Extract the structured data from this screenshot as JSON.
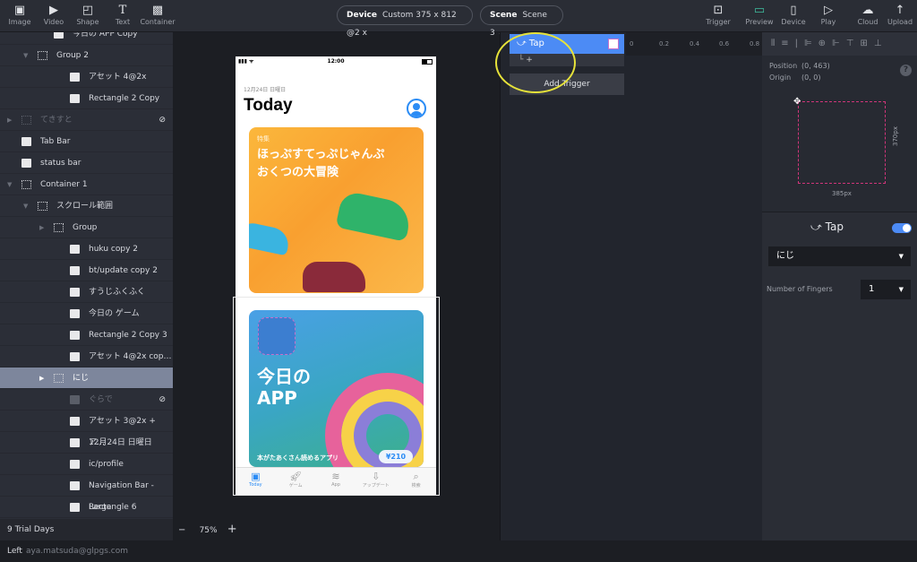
{
  "toolbar": {
    "tools": [
      {
        "label": "Image",
        "icon": "image-icon"
      },
      {
        "label": "Video",
        "icon": "video-icon"
      },
      {
        "label": "Shape",
        "icon": "shape-icon"
      },
      {
        "label": "Text",
        "icon": "text-icon"
      },
      {
        "label": "Container",
        "icon": "container-icon"
      }
    ],
    "device_label": "Device",
    "device_value": "Custom  375 x 812  @2 x",
    "scene_label": "Scene",
    "scene_value": "Scene 3",
    "actions": [
      {
        "label": "Trigger",
        "icon": "trigger-icon"
      },
      {
        "label": "Preview",
        "icon": "preview-icon"
      },
      {
        "label": "Device",
        "icon": "device-icon"
      },
      {
        "label": "Play",
        "icon": "play-icon"
      },
      {
        "label": "Cloud",
        "icon": "cloud-icon"
      },
      {
        "label": "Upload",
        "icon": "upload-icon"
      }
    ]
  },
  "layers": [
    {
      "name": "今日の APP Copy",
      "type": "image"
    },
    {
      "name": "Group 2",
      "type": "group"
    },
    {
      "name": "アセット 4@2x",
      "type": "image"
    },
    {
      "name": "Rectangle 2 Copy",
      "type": "image"
    },
    {
      "name": "てきすと",
      "type": "group",
      "hidden": true
    },
    {
      "name": "Tab Bar",
      "type": "image"
    },
    {
      "name": "status bar",
      "type": "image"
    },
    {
      "name": "Container 1",
      "type": "container"
    },
    {
      "name": "スクロール範囲",
      "type": "group"
    },
    {
      "name": "Group",
      "type": "group"
    },
    {
      "name": "huku copy 2",
      "type": "image"
    },
    {
      "name": "bt/update copy 2",
      "type": "image"
    },
    {
      "name": "すうじふくふく",
      "type": "image"
    },
    {
      "name": "今日の ゲーム",
      "type": "image"
    },
    {
      "name": "Rectangle 2 Copy 3",
      "type": "image"
    },
    {
      "name": "アセット 4@2x cop…",
      "type": "image"
    },
    {
      "name": "にじ",
      "type": "group",
      "selected": true
    },
    {
      "name": "ぐらで",
      "type": "image",
      "hidden": true
    },
    {
      "name": "アセット 3@2x + ア…",
      "type": "image"
    },
    {
      "name": "12月24日 日曜日",
      "type": "image"
    },
    {
      "name": "ic/profile",
      "type": "image"
    },
    {
      "name": "Navigation Bar - Large",
      "type": "image"
    },
    {
      "name": "Rectangle 6",
      "type": "image"
    }
  ],
  "footer": {
    "trial": "9 Trial Days Left",
    "email": "aya.matsuda@glpgs.com",
    "zoom": "75%",
    "minus": "−",
    "plus": "+"
  },
  "phone": {
    "time": "12:00",
    "date": "12月24日 日曜日",
    "title": "Today",
    "card1": {
      "tag": "特集",
      "title1": "ほっぷすてっぷじゃんぷ",
      "title2": "おくつの大冒険"
    },
    "card2": {
      "title1": "今日の",
      "title2": "APP",
      "caption": "本がたあくさん読めるアプリ",
      "price": "¥210"
    },
    "tabs": [
      {
        "label": "Today",
        "icon": "today-icon",
        "active": true
      },
      {
        "label": "ゲーム",
        "icon": "rocket-icon"
      },
      {
        "label": "App",
        "icon": "stack-icon"
      },
      {
        "label": "アップデート",
        "icon": "download-icon"
      },
      {
        "label": "検索",
        "icon": "search-icon"
      }
    ]
  },
  "triggers": {
    "tap_label": "Tap",
    "add_symbol": "+",
    "add_trigger": "Add Trigger",
    "ruler": [
      "0",
      "0.2",
      "0.4",
      "0.6",
      "0.8"
    ]
  },
  "inspector": {
    "position_label": "Position",
    "position_value": "(0, 463)",
    "origin_label": "Origin",
    "origin_value": "(0, 0)",
    "help": "?",
    "width": "385px",
    "height": "370px",
    "gesture": {
      "title": "Tap",
      "enabled": true,
      "target": "にじ",
      "fingers_label": "Number of Fingers",
      "fingers_value": "1"
    }
  },
  "colors": {
    "accent": "#4c8bf5",
    "preview": "#3fbfa0",
    "selection": "#7d869c",
    "highlight": "#e6e23a"
  }
}
